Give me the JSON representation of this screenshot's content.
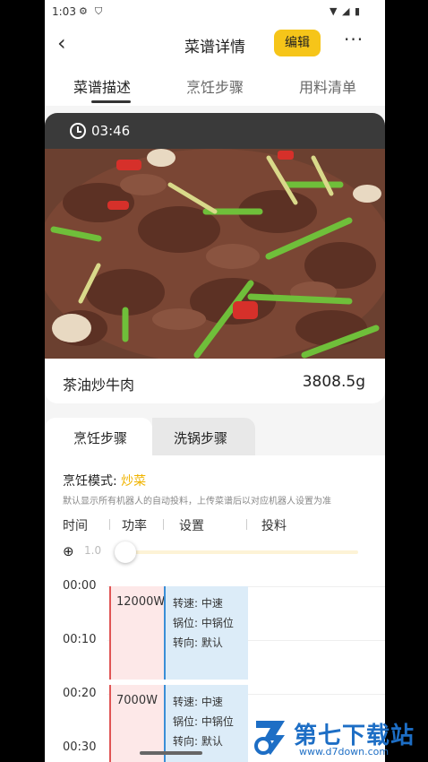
{
  "status_bar": {
    "time": "1:03"
  },
  "header": {
    "title": "菜谱详情",
    "edit_label": "编辑",
    "back_icon": "chevron-left-icon",
    "more_label": "···"
  },
  "tabs": [
    {
      "label": "菜谱描述"
    },
    {
      "label": "烹饪步骤"
    },
    {
      "label": "用料清单"
    }
  ],
  "recipe": {
    "duration": "03:46",
    "name": "茶油炒牛肉",
    "weight": "3808.5g"
  },
  "sub_tabs": [
    {
      "label": "烹饪步骤"
    },
    {
      "label": "洗锅步骤"
    }
  ],
  "cooking": {
    "mode_label": "烹饪模式:",
    "mode_value": "炒菜",
    "note": "默认显示所有机器人的自动投料，上传菜谱后以对应机器人设置为准",
    "columns": [
      "时间",
      "功率",
      "设置",
      "投料"
    ],
    "zoom_value": "1.0",
    "times": [
      "00:00",
      "00:10",
      "00:20",
      "00:30"
    ],
    "steps": [
      {
        "power": "12000W",
        "speed": "转速: 中速",
        "position": "锅位: 中锅位",
        "direction": "转向:  默认"
      },
      {
        "power": "7000W",
        "speed": "转速: 中速",
        "position": "锅位: 中锅位",
        "direction": "转向:  默认"
      }
    ]
  },
  "watermark": {
    "brand": "第七下载站",
    "url": "www.d7down.com"
  },
  "colors": {
    "accent": "#f6c519",
    "power": "#fde8e8",
    "settings": "#dcecf8",
    "mode": "#f0b400"
  }
}
